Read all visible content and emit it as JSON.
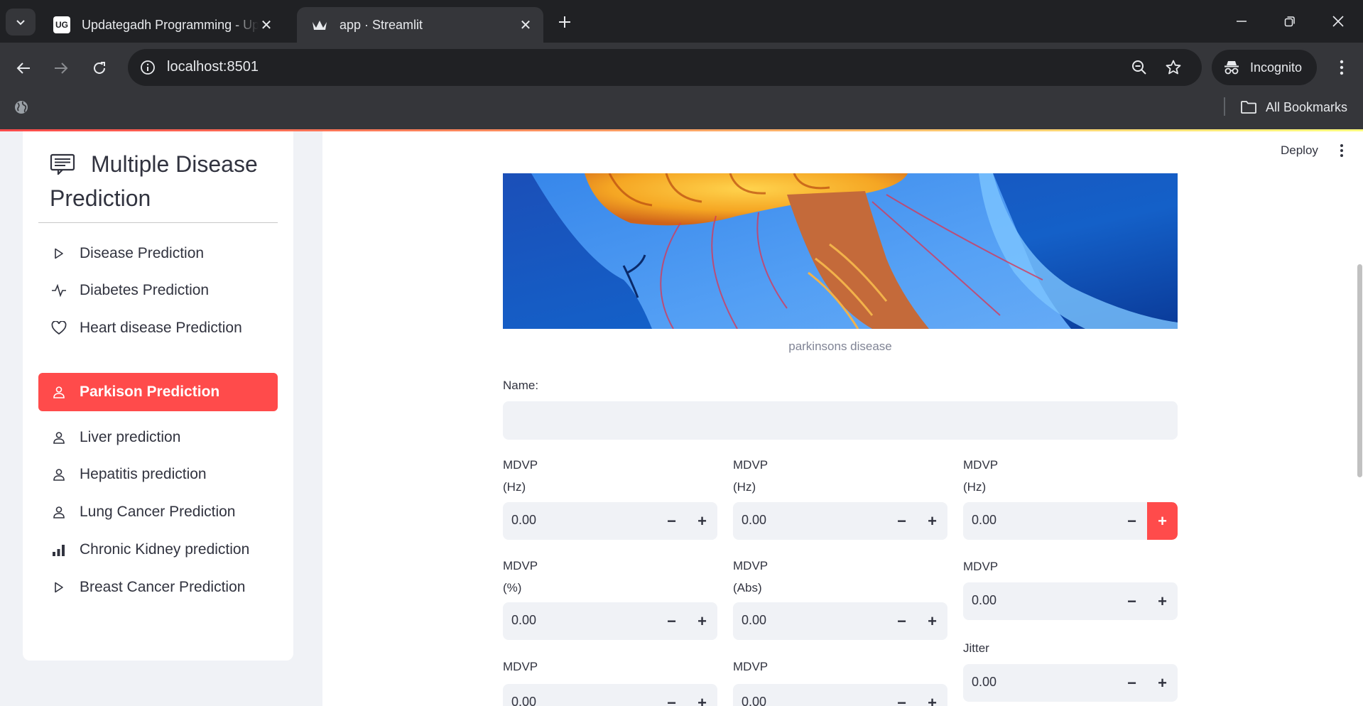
{
  "browser": {
    "tabs": [
      {
        "title": "Updategadh Programming - Up",
        "favicon_text": "UG",
        "active": false
      },
      {
        "title": "app · Streamlit",
        "active": true
      }
    ],
    "address": "localhost:8501",
    "profile_label": "Incognito",
    "bookmarks_label": "All Bookmarks"
  },
  "sidebar": {
    "title": "Multiple Disease Prediction",
    "items": [
      {
        "label": "Disease Prediction",
        "icon": "play-icon"
      },
      {
        "label": "Diabetes Prediction",
        "icon": "activity-icon"
      },
      {
        "label": "Heart disease Prediction",
        "icon": "heart-icon"
      },
      {
        "label": "Parkison Prediction",
        "icon": "person-icon",
        "selected": true
      },
      {
        "label": "Liver prediction",
        "icon": "person-icon"
      },
      {
        "label": "Hepatitis prediction",
        "icon": "person-icon"
      },
      {
        "label": "Lung Cancer Prediction",
        "icon": "person-icon"
      },
      {
        "label": "Chronic Kidney prediction",
        "icon": "bar-chart-icon"
      },
      {
        "label": "Breast Cancer Prediction",
        "icon": "play-icon"
      }
    ]
  },
  "header": {
    "deploy_label": "Deploy"
  },
  "image": {
    "caption": "parkinsons disease"
  },
  "form": {
    "name_label": "Name:",
    "name_value": "",
    "fields": [
      {
        "label_line1": "MDVP",
        "label_line2": "(Hz)",
        "value": "0.00"
      },
      {
        "label_line1": "MDVP",
        "label_line2": "(Hz)",
        "value": "0.00"
      },
      {
        "label_line1": "MDVP",
        "label_line2": "(Hz)",
        "value": "0.00"
      },
      {
        "label_line1": "MDVP",
        "label_line2": "(%)",
        "value": "0.00"
      },
      {
        "label_line1": "MDVP",
        "label_line2": "(Abs)",
        "value": "0.00"
      },
      {
        "label_line1": "MDVP",
        "label_line2": "",
        "value": "0.00"
      },
      {
        "label_line1": "Jitter",
        "label_line2": "",
        "value": "0.00"
      },
      {
        "label_line1": "MDVP",
        "label_line2": "",
        "value": "0.00"
      },
      {
        "label_line1": "MDVP",
        "label_line2": "",
        "value": "0.00"
      }
    ],
    "minus_symbol": "−",
    "plus_symbol": "+"
  },
  "colors": {
    "accent": "#ff4b4b",
    "sidebar_bg": "#f0f2f6",
    "input_bg": "#f0f2f6",
    "text": "#31333f",
    "chrome_dark": "#202124",
    "chrome_mid": "#35363a"
  }
}
